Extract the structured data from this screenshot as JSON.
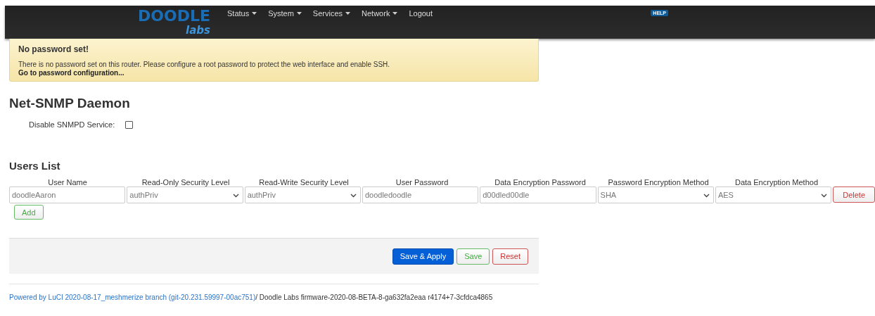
{
  "header": {
    "logo": {
      "top": "DOODLE",
      "bottom": "labs"
    },
    "menu": [
      {
        "label": "Status",
        "dropdown": true
      },
      {
        "label": "System",
        "dropdown": true
      },
      {
        "label": "Services",
        "dropdown": true
      },
      {
        "label": "Network",
        "dropdown": true
      },
      {
        "label": "Logout",
        "dropdown": false
      }
    ],
    "help": "HELP"
  },
  "alert": {
    "title": "No password set!",
    "text": "There is no password set on this router. Please configure a root password to protect the web interface and enable SSH.",
    "link": "Go to password configuration..."
  },
  "page_title": "Net-SNMP Daemon",
  "disable_service": {
    "label": "Disable SNMPD Service:",
    "checked": false
  },
  "users": {
    "title": "Users List",
    "columns": [
      "User Name",
      "Read-Only Security Level",
      "Read-Write Security Level",
      "User Password",
      "Data Encryption Password",
      "Password Encryption Method",
      "Data Encryption Method"
    ],
    "rows": [
      {
        "cells": [
          {
            "kind": "input",
            "value": "doodleAaron"
          },
          {
            "kind": "select",
            "value": "authPriv"
          },
          {
            "kind": "select",
            "value": "authPriv"
          },
          {
            "kind": "input",
            "value": "doodledoodle"
          },
          {
            "kind": "input",
            "value": "d00dled00dle"
          },
          {
            "kind": "select",
            "value": "SHA"
          },
          {
            "kind": "select",
            "value": "AES"
          }
        ],
        "delete": "Delete"
      }
    ],
    "add": "Add"
  },
  "actions": [
    {
      "label": "Save & Apply",
      "kind": "primary"
    },
    {
      "label": "Save",
      "kind": "positive"
    },
    {
      "label": "Reset",
      "kind": "negative"
    }
  ],
  "footer": {
    "link": "Powered by LuCI 2020-08-17_meshmerize branch (git-20.231.59997-00ac751)",
    "text": "/ Doodle Labs firmware-2020-08-BETA-8-ga632fa2eaa r4174+7-3cfdca4865"
  }
}
